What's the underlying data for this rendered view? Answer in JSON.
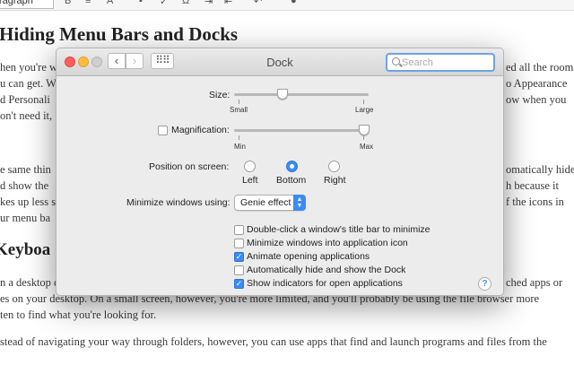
{
  "editor": {
    "format_select": "ragraph",
    "article_title": "Hiding Menu Bars and Docks",
    "paragraph1": [
      "hen you're w",
      "u can get. W",
      "d Personali",
      "on't need it,"
    ],
    "paragraph1_right": [
      "ed all the room",
      "o Appearance",
      "ow when you"
    ],
    "paragraph2": [
      "e same thin",
      "d show the",
      "kes up less s",
      "ur menu ba"
    ],
    "paragraph2_right": [
      "omatically hide",
      "h because it",
      "f the icons in"
    ],
    "section_title": "Keyboa",
    "paragraph3": [
      "n a desktop c",
      "es on your desktop. On a small screen, however, you're more limited, and you'll probably be using the file browser more",
      "ten to find what you're looking for."
    ],
    "paragraph3_right": "ched apps or",
    "paragraph4": "stead of navigating your way through folders, however, you can use apps that find and launch programs and files from the"
  },
  "window": {
    "title": "Dock",
    "search_placeholder": "Search",
    "size_label": "Size:",
    "size_min": "Small",
    "size_max": "Large",
    "size_value": 0.35,
    "magnification_label": "Magnification:",
    "magnification_checked": false,
    "mag_min": "Min",
    "mag_max": "Max",
    "magnification_value": 1.0,
    "position_label": "Position on screen:",
    "positions": [
      {
        "label": "Left",
        "selected": false
      },
      {
        "label": "Bottom",
        "selected": true
      },
      {
        "label": "Right",
        "selected": false
      }
    ],
    "minimize_label": "Minimize windows using:",
    "minimize_value": "Genie effect",
    "options": [
      {
        "label": "Double-click a window's title bar to minimize",
        "checked": false
      },
      {
        "label": "Minimize windows into application icon",
        "checked": false
      },
      {
        "label": "Animate opening applications",
        "checked": true
      },
      {
        "label": "Automatically hide and show the Dock",
        "checked": false
      },
      {
        "label": "Show indicators for open applications",
        "checked": true
      }
    ],
    "help_label": "?"
  }
}
